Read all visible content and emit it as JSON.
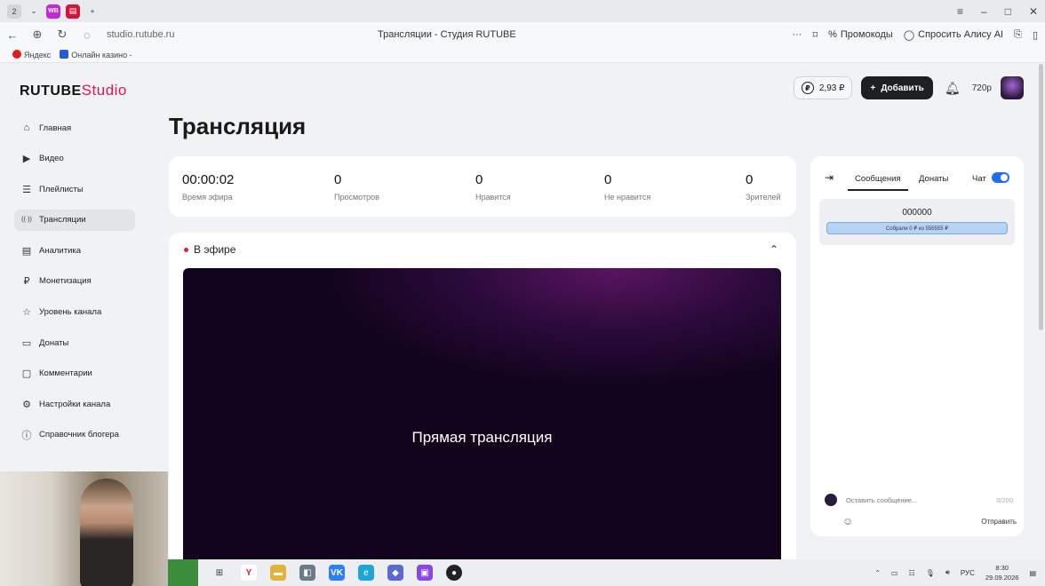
{
  "browser": {
    "tab_count": "2",
    "page_title": "Трансляции - Студия RUTUBE",
    "url": "studio.rutube.ru",
    "promocodes": "Промокоды",
    "ask_alice": "Спросить Алису AI",
    "bookmarks": [
      "Яндекс",
      "Онлайн казино -"
    ]
  },
  "header": {
    "brand_main": "RUTUBE",
    "brand_studio": "Studio",
    "balance": "2,93 ₽",
    "add_label": "Добавить",
    "quality": "720p"
  },
  "sidebar": {
    "items": [
      {
        "label": "Главная",
        "icon": "⌂"
      },
      {
        "label": "Видео",
        "icon": "▶"
      },
      {
        "label": "Плейлисты",
        "icon": "☰"
      },
      {
        "label": "Трансляции",
        "icon": "((·))"
      },
      {
        "label": "Аналитика",
        "icon": "▤"
      },
      {
        "label": "Монетизация",
        "icon": "₽"
      },
      {
        "label": "Уровень канала",
        "icon": "☆"
      },
      {
        "label": "Донаты",
        "icon": "▭"
      },
      {
        "label": "Комментарии",
        "icon": "▢"
      },
      {
        "label": "Настройки канала",
        "icon": "⚙"
      },
      {
        "label": "Справочник блогера",
        "icon": "ⓘ"
      }
    ]
  },
  "page": {
    "title": "Трансляция"
  },
  "stats": {
    "airtime_value": "00:00:02",
    "airtime_label": "Время эфира",
    "views_value": "0",
    "views_label": "Просмотров",
    "likes_value": "0",
    "likes_label": "Нравится",
    "dislikes_value": "0",
    "dislikes_label": "Не нравится",
    "viewers_value": "0",
    "viewers_label": "Зрителей"
  },
  "live": {
    "status": "В эфире",
    "video_label": "Прямая трансляция"
  },
  "chat": {
    "tab_messages": "Сообщения",
    "tab_donations": "Донаты",
    "chat_label": "Чат",
    "goal_amount": "000000",
    "goal_progress": "Собрали 0 ₽ из 555555 ₽",
    "input_placeholder": "Оставить сообщение...",
    "counter": "0/200",
    "send_label": "Отправить"
  },
  "taskbar": {
    "lang": "РУС",
    "time": "8:30",
    "date": "29.09.2026"
  },
  "colors": {
    "accent": "#e3154e",
    "toggle": "#1f6feb",
    "live_dot": "#e31b3f"
  }
}
